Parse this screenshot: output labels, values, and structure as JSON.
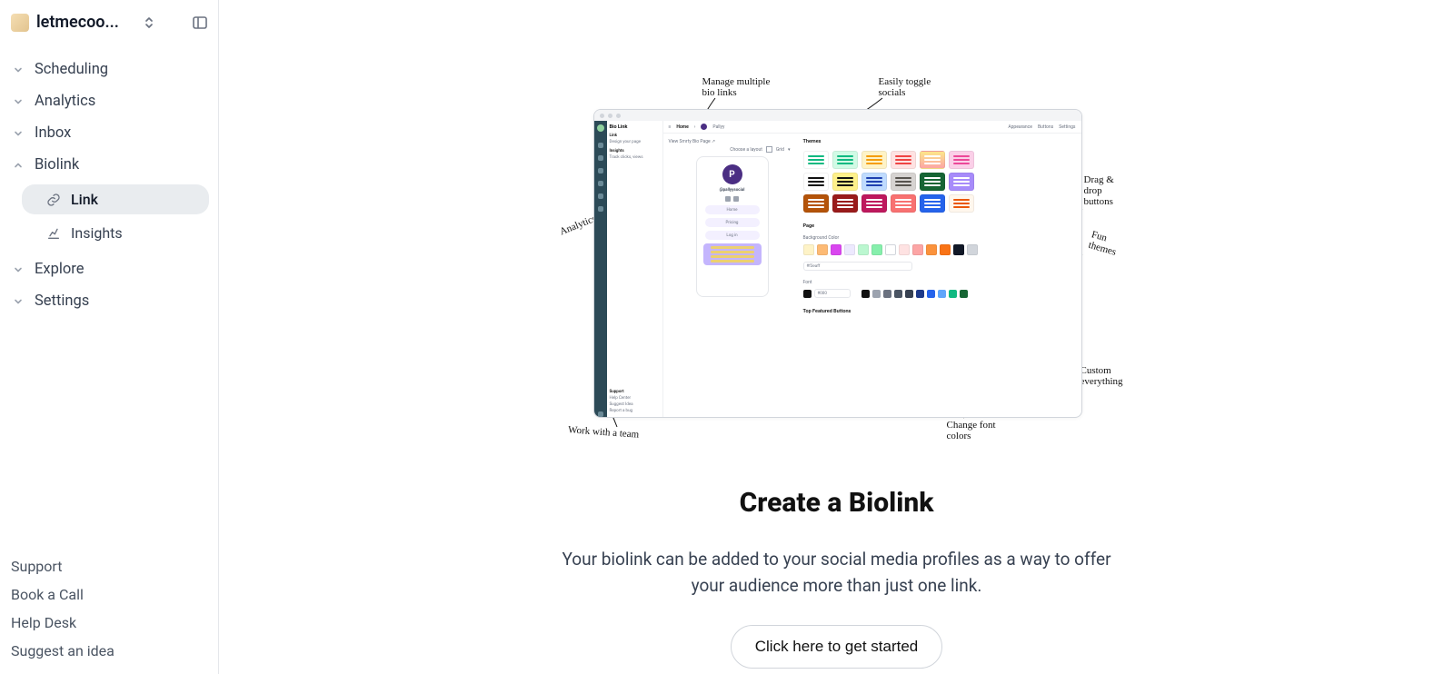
{
  "workspace": {
    "name": "letmecoo..."
  },
  "sidebar": {
    "scheduling": "Scheduling",
    "analytics": "Analytics",
    "inbox": "Inbox",
    "biolink": "Biolink",
    "biolink_link": "Link",
    "biolink_insights": "Insights",
    "explore": "Explore",
    "settings": "Settings"
  },
  "footer": {
    "support": "Support",
    "book": "Book a Call",
    "helpdesk": "Help Desk",
    "suggest": "Suggest an idea"
  },
  "hero": {
    "title": "Create a Biolink",
    "subtitle": "Your biolink can be added to your social media profiles as a way to offer your audience more than just one link.",
    "cta": "Click here to get started"
  },
  "annotations": {
    "manage": "Manage multiple\nbio links",
    "toggle": "Easily toggle\nsocials",
    "drag": "Drag &\ndrop\nbuttons",
    "fun": "Fun\nthemes",
    "custom": "Custom\neverything",
    "fonts": "Change font\ncolors",
    "team": "Work with a team",
    "analytics": "Analytics"
  },
  "window": {
    "brand": "Bio Link",
    "left_link": "Link",
    "left_design": "Design your page",
    "left_insights": "Insights",
    "left_clicks": "Track clicks, views",
    "toolbar_home": "Home",
    "toolbar_pallyy": "Pallyy",
    "toolbar_appearance": "Appearance",
    "toolbar_buttons": "Buttons",
    "toolbar_settings": "Settings",
    "view_label": "View Smrty Bio Page ↗",
    "layout_label": "Choose a layout",
    "layout_grid": "Grid",
    "themes_label": "Themes",
    "page_label": "Page",
    "bg_label": "Background Color",
    "bg_value": "#f3eaff",
    "font_label": "Font",
    "font_value": "#000",
    "featured_label": "Top Featured Buttons",
    "phone_handle": "@pallyysocial",
    "phone_btn1": "Home",
    "phone_btn2": "Pricing",
    "phone_btn3": "Log in"
  },
  "window_bottom": {
    "support": "Support",
    "help_center": "Help Center",
    "suggest": "Suggest Idea",
    "report": "Report a bug"
  }
}
